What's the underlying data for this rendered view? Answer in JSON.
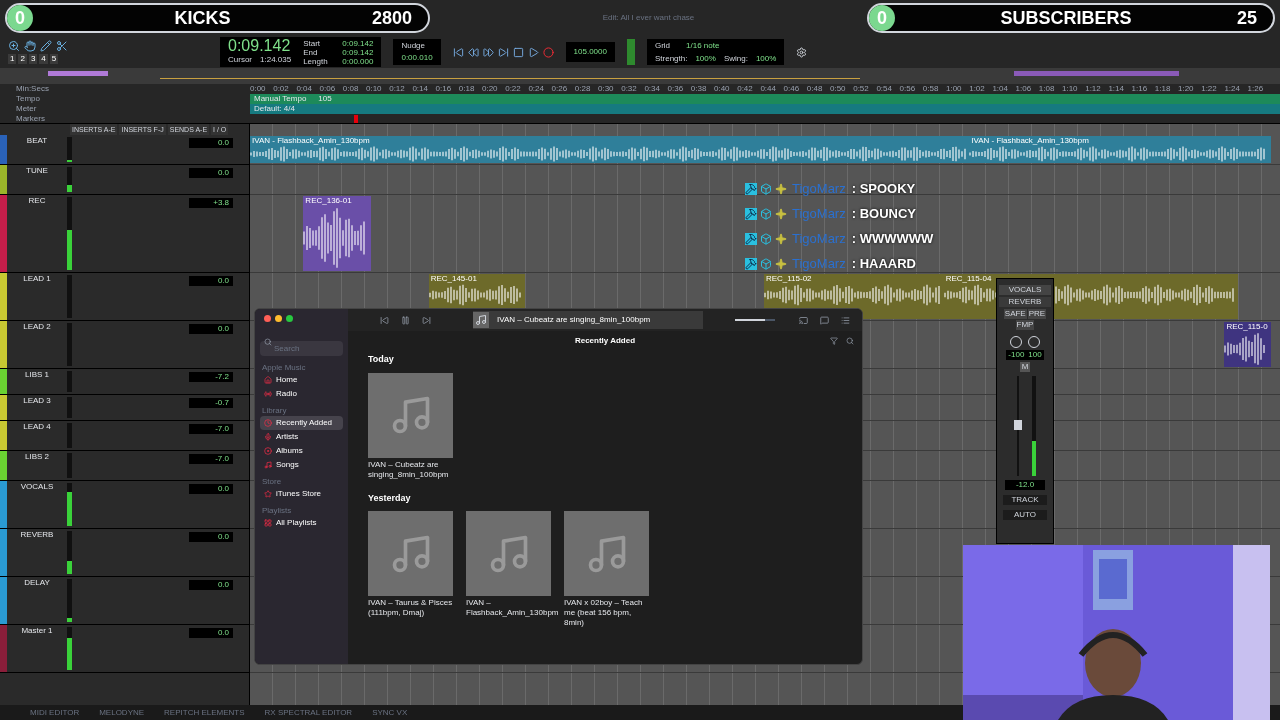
{
  "overlays": [
    {
      "count": "0",
      "label": "KICKS",
      "value": "2800"
    },
    {
      "count": "0",
      "label": "SUBSCRIBERS",
      "value": "25"
    }
  ],
  "window_title": "Edit: All I ever want chase",
  "toolbar": {
    "counter": "0:09.142",
    "cursor_label": "Cursor",
    "cursor": "1:24.035",
    "fields": [
      {
        "label": "Start",
        "value": "0:09.142"
      },
      {
        "label": "End",
        "value": "0:09.142"
      },
      {
        "label": "Length",
        "value": "0:00.000"
      }
    ],
    "nudge_label": "Nudge",
    "nudge": "0:00.010",
    "grid_label": "Grid",
    "grid": "1/16 note",
    "strength_label": "Strength:",
    "strength": "100%",
    "swing_label": "Swing:",
    "swing": "100%",
    "tempo": "105.0000",
    "zoom_presets": [
      "1",
      "2",
      "3",
      "4",
      "5"
    ]
  },
  "rulers": [
    {
      "name": "Min:Secs"
    },
    {
      "name": "Tempo",
      "value": "Manual Tempo",
      "extra": "105"
    },
    {
      "name": "Meter",
      "value": "Default: 4/4"
    },
    {
      "name": "Markers"
    }
  ],
  "ticks": [
    "0:00",
    "0:02",
    "0:04",
    "0:06",
    "0:08",
    "0:10",
    "0:12",
    "0:14",
    "0:16",
    "0:18",
    "0:20",
    "0:22",
    "0:24",
    "0:26",
    "0:28",
    "0:30",
    "0:32",
    "0:34",
    "0:36",
    "0:38",
    "0:40",
    "0:42",
    "0:44",
    "0:46",
    "0:48",
    "0:50",
    "0:52",
    "0:54",
    "0:56",
    "0:58",
    "1:00",
    "1:02",
    "1:04",
    "1:06",
    "1:08",
    "1:10",
    "1:12",
    "1:14",
    "1:16",
    "1:18",
    "1:20",
    "1:22",
    "1:24",
    "1:26"
  ],
  "mix_columns": [
    "INSERTS A-E",
    "INSERTS F-J",
    "SENDS A-E",
    "I / O"
  ],
  "tracks": [
    {
      "name": "BEAT",
      "color": "#2a62b8",
      "level": 0.1,
      "value": "0.0",
      "clips": [
        {
          "name": "IVAN - Flashback_Amin_130bpm",
          "color": "#2f7f9a"
        },
        {
          "name": "IVAN - Flashback_Amin_130bpm",
          "color": "#2f7f9a"
        }
      ]
    },
    {
      "name": "TUNE",
      "color": "#9bb52a",
      "level": 0.3,
      "value": "0.0"
    },
    {
      "name": "REC",
      "color": "#c41e4a",
      "level": 0.55,
      "value": "+3.8",
      "clips": [
        {
          "name": "REC_136-01",
          "color": "#6a4fa8"
        }
      ]
    },
    {
      "name": "LEAD 1",
      "color": "#c8c832",
      "value": "0.0",
      "clips": [
        {
          "name": "REC_145-01",
          "color": "#6d6a2a"
        },
        {
          "name": "REC_115-02",
          "color": "#6d6a2a"
        },
        {
          "name": "REC_115-04",
          "color": "#6d6a2a"
        }
      ]
    },
    {
      "name": "LEAD 2",
      "color": "#c8c832",
      "value": "0.0",
      "clips": [
        {
          "name": "REC_115-0",
          "color": "#3f3480"
        }
      ]
    },
    {
      "name": "LIBS 1",
      "color": "#6ad232",
      "value": "-7.2"
    },
    {
      "name": "LEAD 3",
      "color": "#c8c832",
      "value": "-0.7"
    },
    {
      "name": "LEAD 4",
      "color": "#c8c832",
      "value": "-7.0"
    },
    {
      "name": "LIBS 2",
      "color": "#6ad232",
      "value": "-7.0"
    },
    {
      "name": "VOCALS",
      "color": "#2a9ad2",
      "level": 0.8,
      "value": "0.0"
    },
    {
      "name": "REVERB",
      "color": "#2a9ad2",
      "level": 0.3,
      "value": "0.0"
    },
    {
      "name": "DELAY",
      "color": "#2a9ad2",
      "level": 0.1,
      "value": "0.0"
    },
    {
      "name": "Master 1",
      "color": "#8a1e3a",
      "level": 0.75,
      "value": "0.0"
    }
  ],
  "chat": [
    {
      "user": "TigoMarz",
      "message": ": SPOOKY"
    },
    {
      "user": "TigoMarz",
      "message": ": BOUNCY"
    },
    {
      "user": "TigoMarz",
      "message": ": WWWWWW"
    },
    {
      "user": "TigoMarz",
      "message": ": HAAARD"
    }
  ],
  "mixer_strip": {
    "name": "VOCALS",
    "send": "REVERB",
    "buttons": [
      "SAFE",
      "PRE",
      "FMP"
    ],
    "pan": [
      "-100",
      "100"
    ],
    "mute": "M",
    "volume": "-12.0",
    "level": 0.35,
    "footer": [
      "TRACK",
      "AUTO"
    ]
  },
  "music": {
    "now_playing": "IVAN – Cubeatz are singing_8min_100bpm",
    "volume": {
      "level": 0.75
    },
    "search": {
      "placeholder": "Search"
    },
    "heading": "Recently Added",
    "sidebar": [
      {
        "title": "Apple Music",
        "items": [
          {
            "label": "Home",
            "selected": false
          },
          {
            "label": "Radio",
            "selected": false
          }
        ]
      },
      {
        "title": "Library",
        "items": [
          {
            "label": "Recently Added",
            "selected": true
          },
          {
            "label": "Artists",
            "selected": false
          },
          {
            "label": "Albums",
            "selected": false
          },
          {
            "label": "Songs",
            "selected": false
          }
        ]
      },
      {
        "title": "Store",
        "items": [
          {
            "label": "iTunes Store",
            "selected": false
          }
        ]
      },
      {
        "title": "Playlists",
        "items": [
          {
            "label": "All Playlists",
            "selected": false
          }
        ]
      }
    ],
    "groups": [
      {
        "title": "Today",
        "albums": [
          "IVAN – Cubeatz are singing_8min_100bpm"
        ]
      },
      {
        "title": "Yesterday",
        "albums": [
          "IVAN – Taurus & Pisces (111bpm, Dmaj)",
          "IVAN – Flashback_Amin_130bpm",
          "IVAN x 02boy – Teach me (beat 156 bpm, 8min)"
        ]
      }
    ]
  },
  "bottom_bar": [
    "MIDI EDITOR",
    "MELODYNE",
    "REPITCH ELEMENTS",
    "RX SPECTRAL EDITOR",
    "SYNC VX"
  ]
}
